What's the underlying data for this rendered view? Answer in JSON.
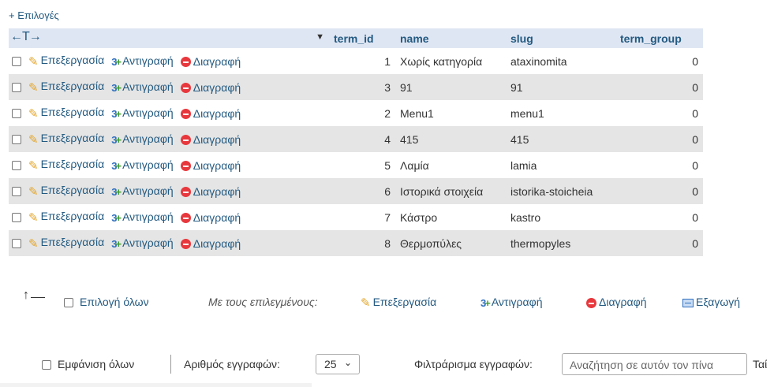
{
  "options_link": "+ Επιλογές",
  "header": {
    "arrows": "←T→",
    "sort_icon": "▼",
    "columns": [
      "term_id",
      "name",
      "slug",
      "term_group"
    ]
  },
  "actions": {
    "edit": "Επεξεργασία",
    "copy": "Αντιγραφή",
    "delete": "Διαγραφή"
  },
  "rows": [
    {
      "term_id": "1",
      "name": "Χωρίς κατηγορία",
      "slug": "ataxinomita",
      "term_group": "0"
    },
    {
      "term_id": "3",
      "name": "91",
      "slug": "91",
      "term_group": "0"
    },
    {
      "term_id": "2",
      "name": "Menu1",
      "slug": "menu1",
      "term_group": "0"
    },
    {
      "term_id": "4",
      "name": "415",
      "slug": "415",
      "term_group": "0"
    },
    {
      "term_id": "5",
      "name": "Λαμία",
      "slug": "lamia",
      "term_group": "0"
    },
    {
      "term_id": "6",
      "name": "Ιστορικά στοιχεία",
      "slug": "istorika-stoicheia",
      "term_group": "0"
    },
    {
      "term_id": "7",
      "name": "Κάστρο",
      "slug": "kastro",
      "term_group": "0"
    },
    {
      "term_id": "8",
      "name": "Θερμοπύλες",
      "slug": "thermopyles",
      "term_group": "0"
    }
  ],
  "bulk": {
    "select_all": "Επιλογή όλων",
    "with_selected": "Με τους επιλεγμένους:",
    "edit": "Επεξεργασία",
    "copy": "Αντιγραφή",
    "delete": "Διαγραφή",
    "export": "Εξαγωγή"
  },
  "bottom": {
    "show_all": "Εμφάνιση όλων",
    "rows_label": "Αριθμός εγγραφών:",
    "rows_value": "25",
    "filter_label": "Φιλτράρισμα εγγραφών:",
    "filter_placeholder": "Αναζήτηση σε αυτόν τον πίνα",
    "truncated_label": "Ταί"
  }
}
